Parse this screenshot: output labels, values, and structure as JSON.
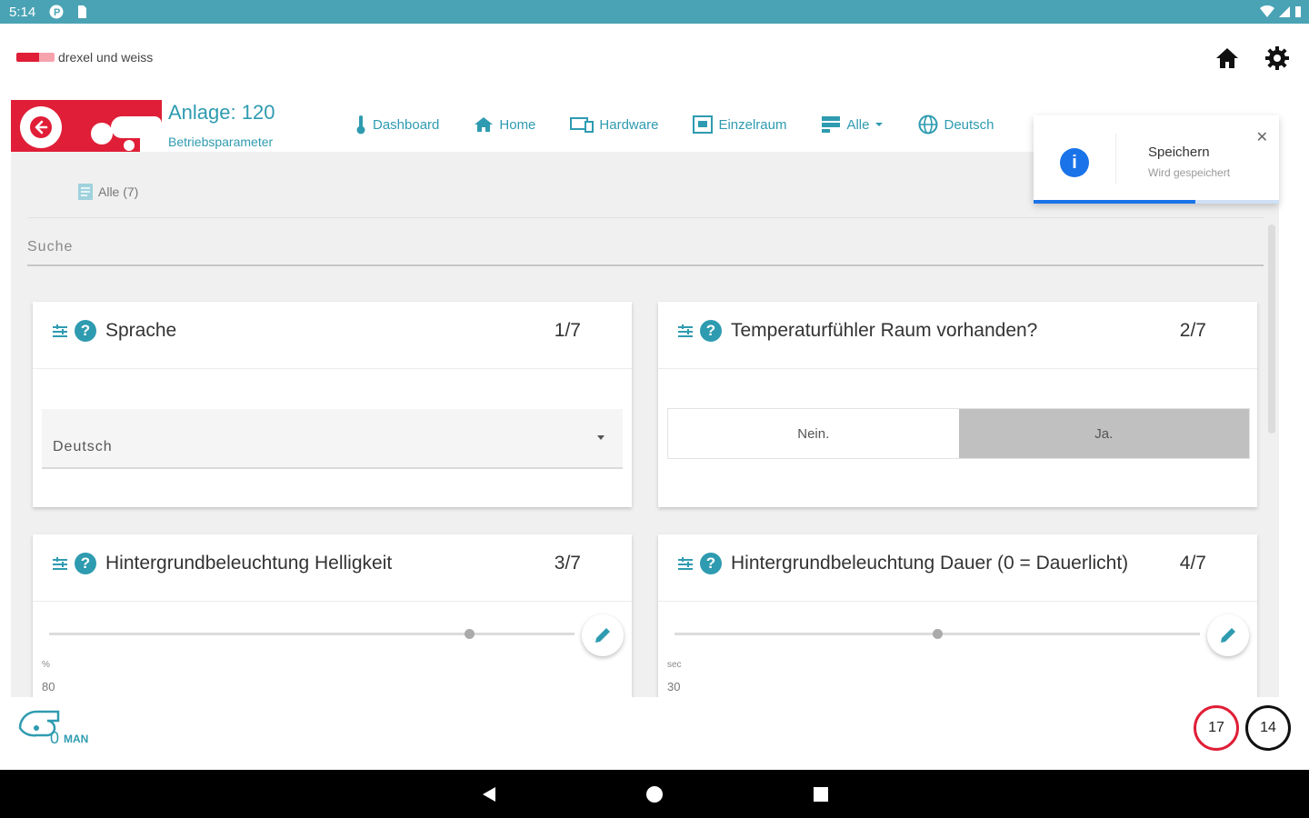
{
  "status_bar": {
    "time": "5:14"
  },
  "brand": {
    "name": "drexel und weiss"
  },
  "header": {
    "home_icon": "home-icon",
    "settings_icon": "gear-icon"
  },
  "system": {
    "title": "Anlage: 120",
    "subtitle": "Betriebsparameter"
  },
  "nav": {
    "tabs": [
      {
        "label": "Dashboard",
        "icon": "thermometer-icon"
      },
      {
        "label": "Home",
        "icon": "home-icon"
      },
      {
        "label": "Hardware",
        "icon": "devices-icon"
      },
      {
        "label": "Einzelraum",
        "icon": "room-icon"
      },
      {
        "label": "Alle",
        "icon": "server-icon"
      },
      {
        "label": "Deutsch",
        "icon": "globe-icon"
      }
    ]
  },
  "filter": {
    "label": "Alle (7)"
  },
  "search": {
    "placeholder": "Suche"
  },
  "cards": [
    {
      "title": "Sprache",
      "count": "1/7",
      "value": "Deutsch"
    },
    {
      "title": "Temperaturfühler Raum vorhanden?",
      "count": "2/7",
      "options": [
        "Nein.",
        "Ja."
      ],
      "selected": "Ja."
    },
    {
      "title": "Hintergrundbeleuchtung Helligkeit",
      "count": "3/7",
      "unit": "%",
      "value": "80",
      "slider_fraction": 0.8
    },
    {
      "title": "Hintergrundbeleuchtung Dauer (0 = Dauerlicht)",
      "count": "4/7",
      "unit": "sec",
      "value": "30",
      "slider_fraction": 0.5
    }
  ],
  "toast": {
    "title": "Speichern",
    "message": "Wird gespeichert",
    "progress": 0.66
  },
  "footer": {
    "fan_level": "0",
    "fan_mode": "MAN",
    "counter_red": "17",
    "counter_dark": "14"
  },
  "colors": {
    "accent": "#2e9bb0",
    "brand_red": "#e01e37",
    "toast_blue": "#1a73e8"
  }
}
